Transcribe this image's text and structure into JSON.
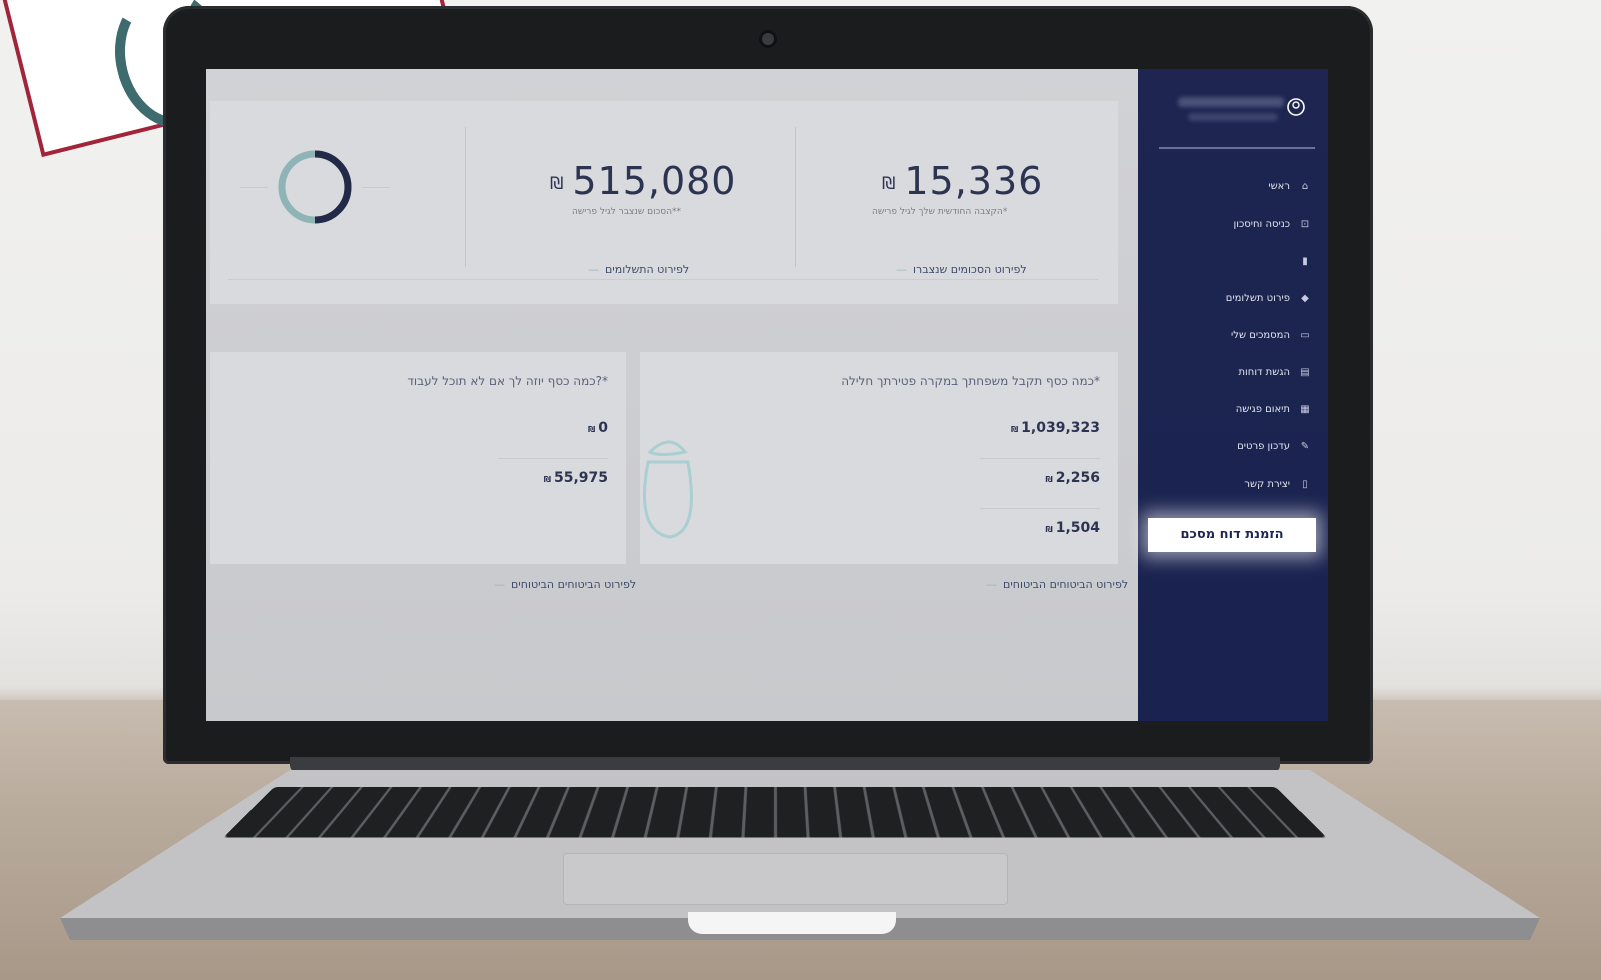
{
  "screen": {
    "stats": {
      "monthly": {
        "value": "15,336",
        "currency": "₪",
        "label": "הקצבה החודשית שלך לגיל פרישה*"
      },
      "total": {
        "value": "515,080",
        "currency": "₪",
        "label": "הסכום שנצבר לגיל פרישה**"
      },
      "monthly_link": "לפירוט הסכומים שנצברו",
      "total_link": "לפירוט התשלומים"
    },
    "panel_right": {
      "title": "כמה כסף תקבל משפחתך במקרה פטירתך חלילה*",
      "items": [
        {
          "value": "1,039,323",
          "currency": "₪"
        },
        {
          "value": "2,256",
          "currency": "₪"
        },
        {
          "value": "1,504",
          "currency": "₪"
        }
      ],
      "link": "לפירוט הביטוחים הביטוחים"
    },
    "panel_left": {
      "title": "כמה כסף יוזה לך אם לא תוכל לעבוד?*",
      "items": [
        {
          "value": "0",
          "currency": "₪"
        },
        {
          "value": "55,975",
          "currency": "₪"
        }
      ],
      "link": "לפירוט הביטוחים הביטוחים"
    },
    "sidebar": {
      "items": [
        {
          "label": "ראשי",
          "icon": "home-icon",
          "glyph": "⌂"
        },
        {
          "label": "כניסה וחיסכון",
          "icon": "lock-icon",
          "glyph": "⊡"
        },
        {
          "label": "",
          "icon": "chart-icon",
          "glyph": "▮"
        },
        {
          "label": "פירוט תשלומים",
          "icon": "diamond-icon",
          "glyph": "◆"
        },
        {
          "label": "המסמכים שלי",
          "icon": "folder-icon",
          "glyph": "▭"
        },
        {
          "label": "הגשת דוחות",
          "icon": "document-icon",
          "glyph": "▤"
        },
        {
          "label": "תיאום פגישה",
          "icon": "calendar-icon",
          "glyph": "▦"
        },
        {
          "label": "עדכון פרטים",
          "icon": "edit-icon",
          "glyph": "✎"
        },
        {
          "label": "יצירת קשר",
          "icon": "phone-icon",
          "glyph": "▯"
        }
      ],
      "cta": "הזמנת דוח מסכם"
    }
  },
  "colors": {
    "sidebar": "#1d2550",
    "accent": "#8fb9bd",
    "sticker_border": "#a1243a"
  }
}
